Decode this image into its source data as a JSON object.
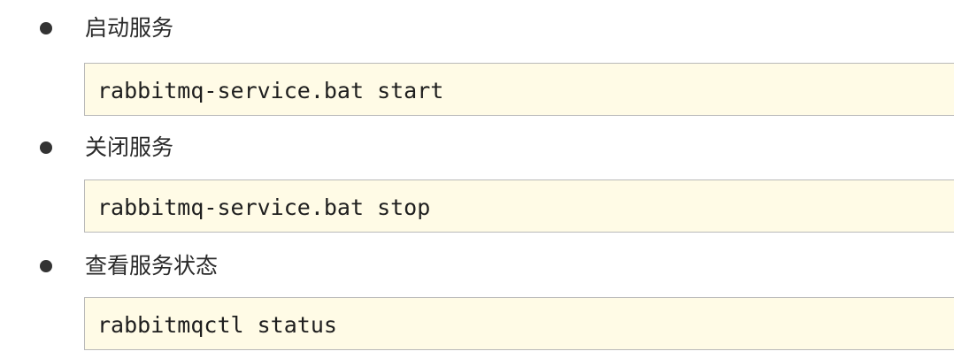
{
  "sections": [
    {
      "label": "启动服务",
      "command": "rabbitmq-service.bat start"
    },
    {
      "label": "关闭服务",
      "command": "rabbitmq-service.bat stop"
    },
    {
      "label": "查看服务状态",
      "command": "rabbitmqctl status"
    }
  ],
  "colors": {
    "code_background": "#fffbe6",
    "code_border": "#b9b9b9",
    "bullet": "#333333"
  }
}
